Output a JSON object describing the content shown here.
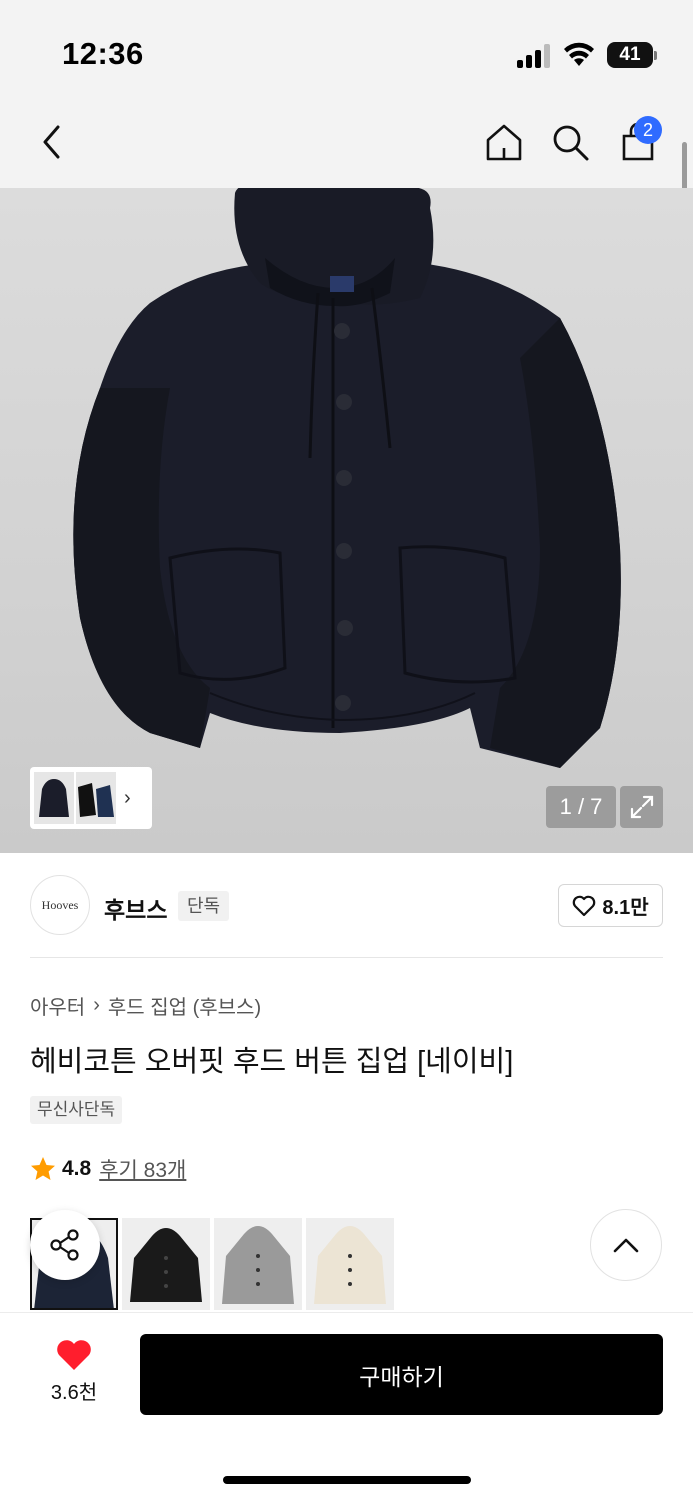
{
  "status_bar": {
    "time": "12:36",
    "battery": "41",
    "icons": [
      "signal-icon",
      "wifi-icon",
      "battery-icon"
    ]
  },
  "nav": {
    "icons": [
      "back-chevron-icon",
      "home-icon",
      "search-icon",
      "cart-icon"
    ],
    "cart_badge": "2"
  },
  "hero": {
    "image": "navy-hooded-button-cardigan-photo",
    "counter": "1 / 7",
    "expand_icon": "expand-icon"
  },
  "brand": {
    "logo_text": "Hooves",
    "name": "후브스",
    "tag": "단독",
    "likes": "8.1만"
  },
  "product": {
    "breadcrumb": [
      "아우터",
      "후드 집업 (후브스)"
    ],
    "title": "헤비코튼 오버핏 후드 버튼 집업 [네이비]",
    "exclusive_tag": "무신사단독",
    "rating": "4.8",
    "reviews": "후기 83개"
  },
  "swatches": [
    {
      "color": "navy",
      "hex": "#1c2436"
    },
    {
      "color": "black",
      "hex": "#1a1a1a"
    },
    {
      "color": "gray",
      "hex": "#9a9a9a"
    },
    {
      "color": "ivory",
      "hex": "#ece4d4"
    }
  ],
  "bottom": {
    "heart_count": "3.6천",
    "buy_label": "구매하기"
  },
  "colors": {
    "accent_blue": "#2f6bff",
    "heart_red": "#ff1e2d",
    "star_orange": "#ff9c00"
  }
}
